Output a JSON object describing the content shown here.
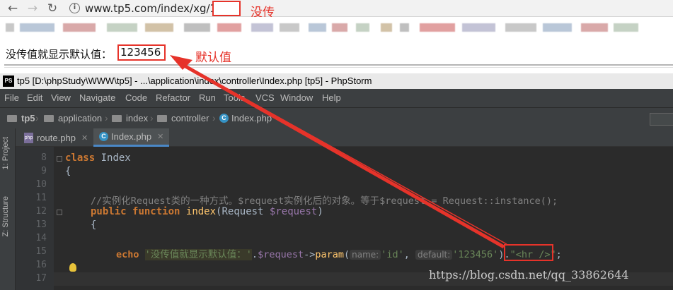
{
  "browser": {
    "url": "www.tp5.com/index/xg/11",
    "annotation_missing": "没传",
    "annotation_default": "默认值",
    "page_label": "没传值就显示默认值：",
    "page_value": "123456",
    "bookmark_colors": [
      "#c8c8c8",
      "#b9c7d8",
      "#d9a9a9",
      "#c5d2c4",
      "#d2c2a7",
      "#bfbfbf",
      "#e1a0a0",
      "#c3c3d6"
    ]
  },
  "ide": {
    "title": "tp5 [D:\\phpStudy\\WWW\\tp5] - ...\\application\\index\\controller\\Index.php [tp5] - PhpStorm",
    "logo": "PS",
    "menu": [
      "File",
      "Edit",
      "View",
      "Navigate",
      "Code",
      "Refactor",
      "Run",
      "Tools",
      "VCS",
      "Window",
      "Help"
    ],
    "breadcrumb": [
      "tp5",
      "application",
      "index",
      "controller",
      "Index.php"
    ],
    "side_tabs": [
      "1: Project",
      "Z: Structure"
    ],
    "tabs": [
      {
        "label": "route.php",
        "active": false
      },
      {
        "label": "Index.php",
        "active": true
      }
    ],
    "line_numbers": [
      "8",
      "9",
      "10",
      "11",
      "12",
      "13",
      "14",
      "15",
      "16",
      "17"
    ],
    "code": {
      "l8_kw": "class",
      "l8_name": " Index",
      "l9": "{",
      "l11": "//实例化Request类的一种方式。$request实例化后的对象。等于$request = Request::instance();",
      "l12_kw1": "public",
      "l12_kw2": "function",
      "l12_fn": "index",
      "l12_rest": "(Request ",
      "l12_var": "$request",
      "l12_end": ")",
      "l13": "{",
      "l15_kw": "echo",
      "l15_str1": "'没传值就显示默认值：'",
      "l15_dot": ".",
      "l15_var": "$request",
      "l15_arrow": "->",
      "l15_fn": "param",
      "l15_paren": "(",
      "l15_hint1": "name:",
      "l15_arg1": "'id'",
      "l15_comma": ",",
      "l15_hint2": "default:",
      "l15_arg2": "'123456'",
      "l15_close": ").",
      "l15_str2": "\"<hr />\"",
      "l15_semi": ";"
    }
  },
  "watermark": "https://blog.csdn.net/qq_33862644"
}
